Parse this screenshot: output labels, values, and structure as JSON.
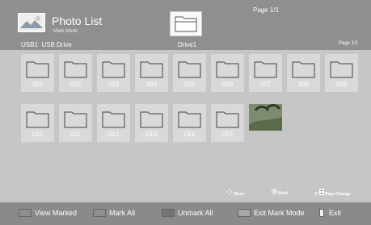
{
  "header": {
    "title": "Photo List",
    "mode": "Mark Mode",
    "device": "USB1",
    "device_name": "USB Drive",
    "drive": "Drive1",
    "page_top": "Page 1/1",
    "page_right": "Page 1/1",
    "logo_icon": "photo-icon",
    "drive_icon": "folder-icon"
  },
  "items": [
    {
      "label": "001"
    },
    {
      "label": "002"
    },
    {
      "label": "003"
    },
    {
      "label": "004"
    },
    {
      "label": "005"
    },
    {
      "label": "006"
    },
    {
      "label": "007"
    },
    {
      "label": "008"
    },
    {
      "label": "009"
    },
    {
      "label": "010"
    },
    {
      "label": "011"
    },
    {
      "label": "012"
    },
    {
      "label": "013"
    },
    {
      "label": "014"
    },
    {
      "label": "015"
    }
  ],
  "hints": {
    "move": "Move",
    "mark": "Mark",
    "p": "P",
    "page_change": "Page Change",
    "move_icon": "dpad-icon",
    "mark_icon": "ok-icon",
    "page_icon": "page-updown-icon"
  },
  "footer": {
    "view_marked": "View Marked",
    "mark_all": "Mark All",
    "unmark_all": "Unmark All",
    "exit_mark_mode": "Exit Mark Mode",
    "exit": "Exit",
    "colors": {
      "view_marked": "#8f8f8f",
      "mark_all": "#8f8f8f",
      "unmark_all": "#737373",
      "exit_mark_mode": "#a6a6a6",
      "exit": "#f0f0f0"
    }
  },
  "colors": {
    "header": "#8f8f8f",
    "background": "#c6c6c6",
    "tile": "#d9d9d9"
  }
}
